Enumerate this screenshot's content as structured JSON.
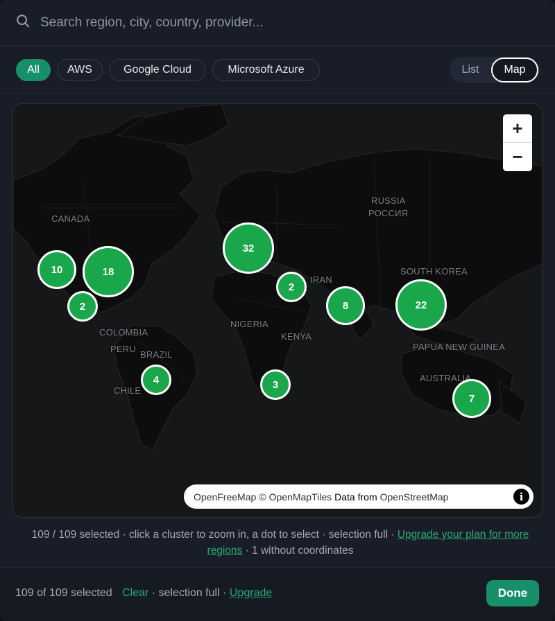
{
  "search": {
    "placeholder": "Search region, city, country, provider..."
  },
  "filters": [
    {
      "label": "All",
      "active": true
    },
    {
      "label": "AWS",
      "active": false
    },
    {
      "label": "Google Cloud",
      "active": false
    },
    {
      "label": "Microsoft Azure",
      "active": false
    }
  ],
  "view_toggle": {
    "list_label": "List",
    "map_label": "Map",
    "selected": "Map"
  },
  "map": {
    "labels": {
      "canada": "CANADA",
      "russia_en": "RUSSIA",
      "russia_ru": "РОССИЯ",
      "south_korea": "SOUTH KOREA",
      "iran": "IRAN",
      "nigeria": "NIGERIA",
      "kenya": "KENYA",
      "colombia": "COLOMBIA",
      "peru": "PERU",
      "brazil": "BRAZIL",
      "chile": "CHILE",
      "papua": "PAPUA NEW GUINEA",
      "australia": "AUSTRALIA"
    },
    "clusters": {
      "us_west": "10",
      "us_east": "18",
      "mexico": "2",
      "europe": "32",
      "middle_east": "2",
      "india": "8",
      "east_asia": "22",
      "brazil": "4",
      "south_africa": "3",
      "australia": "7"
    },
    "zoom_in": "+",
    "zoom_out": "−",
    "attribution": {
      "openfreemap": "OpenFreeMap",
      "copyright": "©",
      "openmaptiles": "OpenMapTiles",
      "data_from": "Data from",
      "openstreetmap": "OpenStreetMap",
      "info": "i"
    }
  },
  "status": {
    "text": "109 / 109 selected · click a cluster to zoom in, a dot to select · selection full · ",
    "upgrade_link": "Upgrade your plan for more regions",
    "suffix": " · 1 without coordinates"
  },
  "footer": {
    "selected_text": "109 of 109 selected",
    "clear": "Clear",
    "full_text": "· selection full ·",
    "upgrade": "Upgrade",
    "done": "Done"
  },
  "colors": {
    "accent": "#17906a",
    "cluster": "#1aa64a",
    "link": "#2aa879"
  }
}
